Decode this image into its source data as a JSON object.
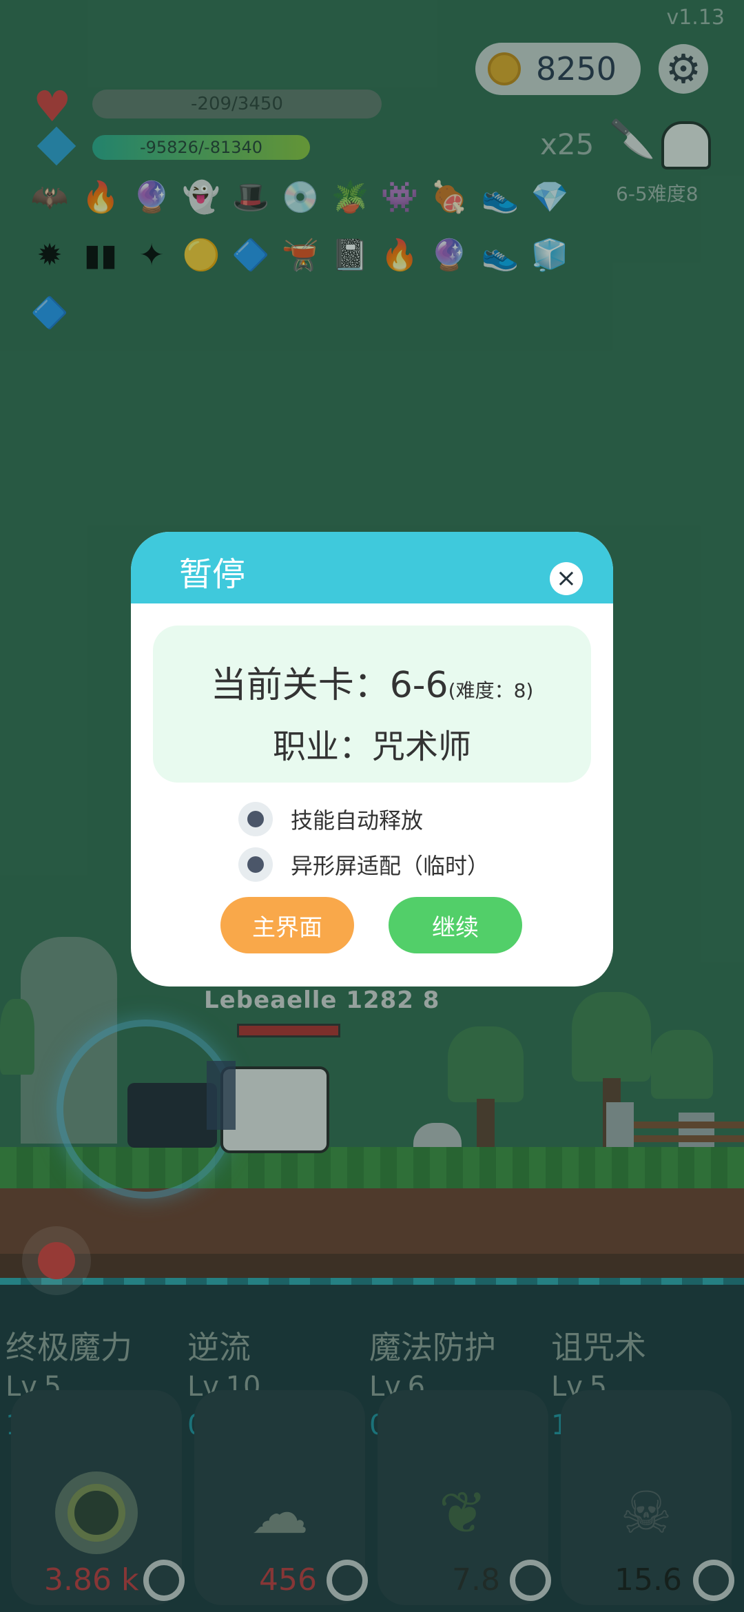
{
  "hud": {
    "version": "v1.13",
    "coins": "8250",
    "hp_text": "-209/3450",
    "mp_text": "-95826/-81340",
    "multiplier": "x25",
    "stage_difficulty": "6-5难度8"
  },
  "pause_dialog": {
    "title": "暂停",
    "current_level_label": "当前关卡：",
    "current_level_value": "6-6",
    "difficulty_note": "(难度：8)",
    "job_label": "职业：咒术师",
    "option_auto_skill": "技能自动释放",
    "option_notch_fit": "异形屏适配（临时）",
    "main_menu_button": "主界面",
    "continue_button": "继续"
  },
  "enemy": {
    "name": "Lebeaelle 1282 8"
  },
  "skills": [
    {
      "name": "终极魔力",
      "level": "Lv.5",
      "value": "100",
      "cost": "3.86 k",
      "icon": "eye-icon",
      "cost_color": "#c0343a"
    },
    {
      "name": "逆流",
      "level": "Lv.10",
      "value": "0",
      "cost": "456",
      "icon": "wing-icon",
      "cost_color": "#c0343a"
    },
    {
      "name": "魔法防护",
      "level": "Lv.6",
      "value": "0",
      "cost": "7.8",
      "icon": "leaf-icon",
      "cost_color": "#222222"
    },
    {
      "name": "诅咒术",
      "level": "Lv.5",
      "value": "10",
      "cost": "15.6",
      "icon": "skull-icon",
      "cost_color": "#111111"
    }
  ],
  "colors": {
    "modal_header": "#3fc9dc",
    "main_menu_button": "#f9a84a",
    "continue_button": "#52cf69"
  }
}
